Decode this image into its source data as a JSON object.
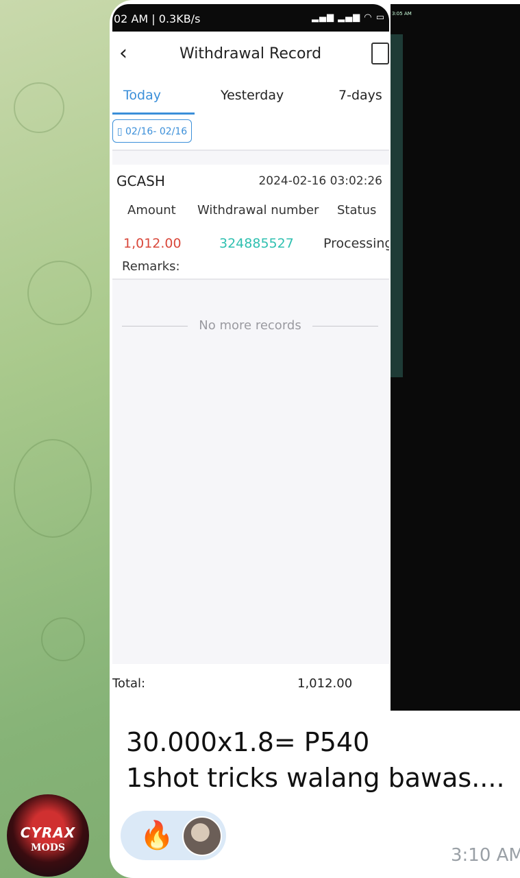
{
  "status_bar": {
    "left_text": "02 AM | 0.3KB/s",
    "right_icons": "signal wifi battery"
  },
  "app_bar": {
    "back_icon": "chevron-left-icon",
    "title": "Withdrawal Record",
    "clipboard_icon": "clipboard-icon"
  },
  "tabs": [
    {
      "label": "Today",
      "active": true
    },
    {
      "label": "Yesterday",
      "active": false
    },
    {
      "label": "7-days",
      "active": false
    }
  ],
  "date_filter": "02/16- 02/16",
  "record": {
    "method": "GCASH",
    "datetime": "2024-02-16 03:02:26",
    "headers": [
      "Amount",
      "Withdrawal number",
      "Status"
    ],
    "amount": "1,012.00",
    "withdrawal_number": "324885527",
    "status": "Processing",
    "remarks_label": "Remarks:"
  },
  "no_more": "No more records",
  "total": {
    "label": "Total:",
    "value": "1,012.00"
  },
  "second_screenshot": {
    "time_text": "3:05 AM"
  },
  "message": {
    "line1": "30.000x1.8= P540",
    "line2": "1shot tricks walang bawas....",
    "reaction_emoji": "🔥",
    "time": "3:10 AM"
  },
  "avatar": {
    "brand": "CYRAX",
    "sub": "MODS"
  },
  "colors": {
    "amount": "#d9483b",
    "withdrawal_number": "#2fc0b0",
    "active_tab": "#3b8fd9"
  }
}
